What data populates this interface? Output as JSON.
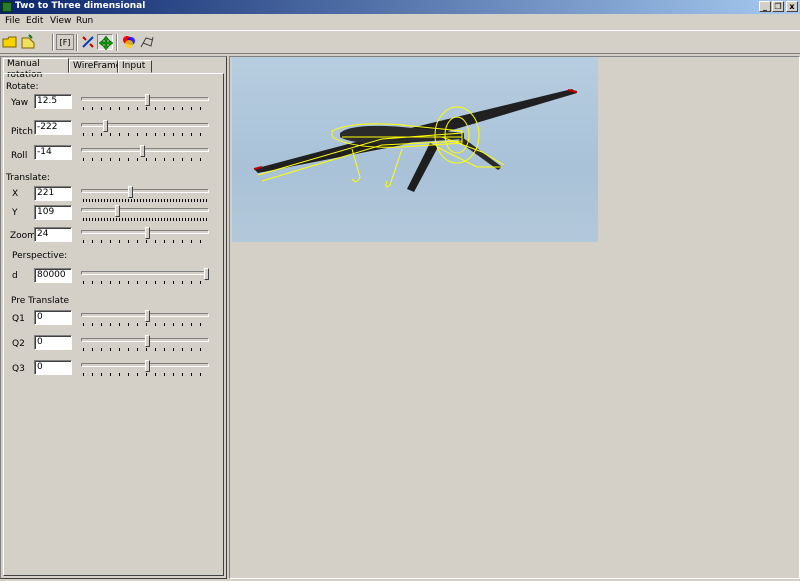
{
  "window": {
    "title": "Two to Three dimensional",
    "min": "_",
    "restore": "❐",
    "close": "x"
  },
  "menu": [
    {
      "label": "File"
    },
    {
      "label": "Edit"
    },
    {
      "label": "View"
    },
    {
      "label": "Run"
    }
  ],
  "toolbar": {
    "buttons": [
      "open-folder",
      "open-file",
      "blank",
      "frame",
      "rotate-tool",
      "move-tool",
      "color-tool",
      "wireframe-tool"
    ],
    "frame_label": "[F]"
  },
  "tabs": [
    {
      "label": "Manual rotation"
    },
    {
      "label": "WireFrame"
    },
    {
      "label": "Input"
    }
  ],
  "sections": {
    "rotate": "Rotate:",
    "translate": "Translate:",
    "perspective": "Perspective:",
    "pretranslate": "Pre Translate"
  },
  "controls": {
    "yaw": {
      "label": "Yaw",
      "value": "12.5",
      "slider": 0.52
    },
    "pitch": {
      "label": "Pitch",
      "value": "-222",
      "slider": 0.18
    },
    "roll": {
      "label": "Roll",
      "value": "-14",
      "slider": 0.48
    },
    "x": {
      "label": "X",
      "value": "221",
      "slider": 0.38
    },
    "y": {
      "label": "Y",
      "value": "109",
      "slider": 0.28
    },
    "zoom": {
      "label": "Zoom",
      "value": "24",
      "slider": 0.52
    },
    "d": {
      "label": "d",
      "value": "80000",
      "slider": 1.0
    },
    "q1": {
      "label": "Q1",
      "value": "0",
      "slider": 0.52
    },
    "q2": {
      "label": "Q2",
      "value": "0",
      "slider": 0.52
    },
    "q3": {
      "label": "Q3",
      "value": "0",
      "slider": 0.52
    }
  },
  "colors": {
    "titlebar_start": "#0a246a",
    "titlebar_end": "#a6caf0",
    "wireframe": "#ffff00",
    "window_bg": "#d4d0c8"
  }
}
